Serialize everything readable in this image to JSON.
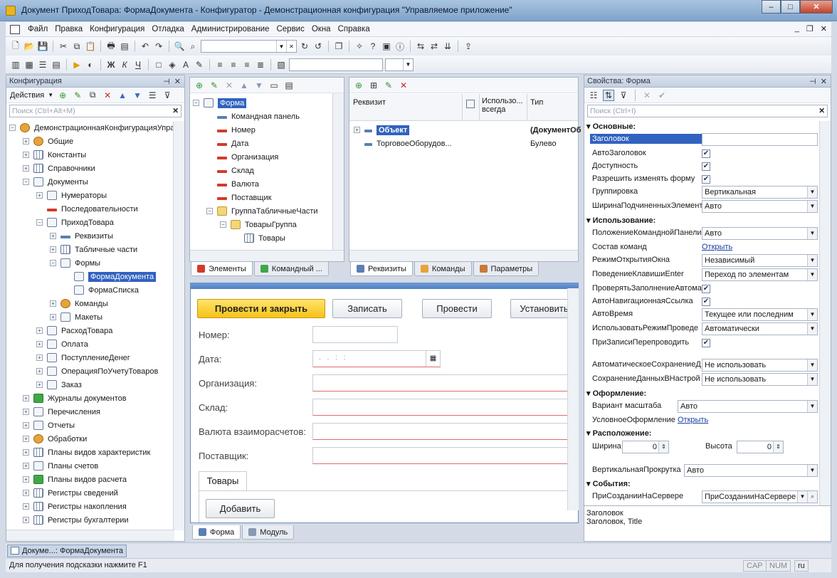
{
  "window": {
    "title": "Документ ПриходТовара: ФормаДокумента - Конфигуратор - Демонстрационная конфигурация \"Управляемое приложение\"",
    "min": "–",
    "max": "□",
    "close": "✕"
  },
  "menu": [
    "Файл",
    "Правка",
    "Конфигурация",
    "Отладка",
    "Администрирование",
    "Сервис",
    "Окна",
    "Справка"
  ],
  "mdi": {
    "min": "_",
    "restore": "❐",
    "close": "✕"
  },
  "toolbar": {
    "search_value": ""
  },
  "config_panel": {
    "title": "Конфигурация",
    "actions_label": "Действия",
    "search_placeholder": "Поиск (Ctrl+Alt+M)",
    "tree": [
      {
        "label": "ДемонстрационнаяКонфигурацияУправ",
        "level": 0,
        "icon": "gear"
      },
      {
        "label": "Общие",
        "level": 1,
        "icon": "gear"
      },
      {
        "label": "Константы",
        "level": 1,
        "icon": "grid"
      },
      {
        "label": "Справочники",
        "level": 1,
        "icon": "grid"
      },
      {
        "label": "Документы",
        "level": 1,
        "icon": "doc"
      },
      {
        "label": "Нумераторы",
        "level": 2,
        "icon": "num"
      },
      {
        "label": "Последовательности",
        "level": 2,
        "icon": "red"
      },
      {
        "label": "ПриходТовара",
        "level": 2,
        "icon": "doc"
      },
      {
        "label": "Реквизиты",
        "level": 3,
        "icon": "blue"
      },
      {
        "label": "Табличные части",
        "level": 3,
        "icon": "grid"
      },
      {
        "label": "Формы",
        "level": 3,
        "icon": "doc"
      },
      {
        "label": "ФормаДокумента",
        "level": 4,
        "icon": "doc"
      },
      {
        "label": "ФормаСписка",
        "level": 4,
        "icon": "doc"
      },
      {
        "label": "Команды",
        "level": 3,
        "icon": "gear"
      },
      {
        "label": "Макеты",
        "level": 3,
        "icon": "doc"
      },
      {
        "label": "РасходТовара",
        "level": 2,
        "icon": "doc"
      },
      {
        "label": "Оплата",
        "level": 2,
        "icon": "doc"
      },
      {
        "label": "ПоступлениеДенег",
        "level": 2,
        "icon": "doc"
      },
      {
        "label": "ОперацияПоУчетуТоваров",
        "level": 2,
        "icon": "doc"
      },
      {
        "label": "Заказ",
        "level": 2,
        "icon": "doc"
      },
      {
        "label": "Журналы документов",
        "level": 1,
        "icon": "green"
      },
      {
        "label": "Перечисления",
        "level": 1,
        "icon": "doc"
      },
      {
        "label": "Отчеты",
        "level": 1,
        "icon": "doc"
      },
      {
        "label": "Обработки",
        "level": 1,
        "icon": "gear"
      },
      {
        "label": "Планы видов характеристик",
        "level": 1,
        "icon": "grid"
      },
      {
        "label": "Планы счетов",
        "level": 1,
        "icon": "num"
      },
      {
        "label": "Планы видов расчета",
        "level": 1,
        "icon": "green"
      },
      {
        "label": "Регистры сведений",
        "level": 1,
        "icon": "grid"
      },
      {
        "label": "Регистры накопления",
        "level": 1,
        "icon": "grid"
      },
      {
        "label": "Регистры бухгалтерии",
        "level": 1,
        "icon": "grid"
      }
    ]
  },
  "elements_panel": {
    "tree": [
      {
        "label": "Форма",
        "level": 0,
        "icon": "doc",
        "selected": true
      },
      {
        "label": "Командная панель",
        "level": 1,
        "icon": "blue"
      },
      {
        "label": "Номер",
        "level": 1,
        "icon": "red"
      },
      {
        "label": "Дата",
        "level": 1,
        "icon": "red"
      },
      {
        "label": "Организация",
        "level": 1,
        "icon": "red"
      },
      {
        "label": "Склад",
        "level": 1,
        "icon": "red"
      },
      {
        "label": "Валюта",
        "level": 1,
        "icon": "red"
      },
      {
        "label": "Поставщик",
        "level": 1,
        "icon": "red"
      },
      {
        "label": "ГруппаТабличныеЧасти",
        "level": 1,
        "icon": "fold"
      },
      {
        "label": "ТоварыГруппа",
        "level": 2,
        "icon": "fold"
      },
      {
        "label": "Товары",
        "level": 3,
        "icon": "grid"
      }
    ],
    "tabs": [
      "Элементы",
      "Командный ..."
    ]
  },
  "attributes_panel": {
    "columns": [
      "Реквизит",
      "Использо... всегда",
      "Тип"
    ],
    "rows": [
      {
        "name": "Объект",
        "type": "(ДокументОб",
        "selected": true
      },
      {
        "name": "ТорговоеОборудов...",
        "type": "Булево"
      }
    ],
    "tabs": [
      "Реквизиты",
      "Команды",
      "Параметры"
    ]
  },
  "form_preview": {
    "buttons": [
      "Провести и закрыть",
      "Записать",
      "Провести",
      "Установить"
    ],
    "fields": [
      "Номер:",
      "Дата:",
      "Организация:",
      "Склад:",
      "Валюта взаиморасчетов:",
      "Поставщик:"
    ],
    "date_mask": ". .   : :",
    "tab": "Товары",
    "add_button": "Добавить"
  },
  "editor_tabs": [
    "Форма",
    "Модуль"
  ],
  "properties": {
    "title": "Свойства: Форма",
    "search_placeholder": "Поиск (Ctrl+I)",
    "sections": {
      "basic": "Основные:",
      "usage": "Использование:",
      "design": "Оформление:",
      "layout": "Расположение:",
      "events": "События:"
    },
    "rows": {
      "title_label": "Заголовок",
      "auto_title": "АвтоЗаголовок",
      "enabled": "Доступность",
      "allow_change": "Разрешить изменять форму",
      "grouping": "Группировка",
      "grouping_value": "Вертикальная",
      "child_width": "ШиринаПодчиненныхЭлемент",
      "child_width_value": "Авто",
      "cmdbar_pos": "ПоложениеКоманднойПанели",
      "cmdbar_pos_value": "Авто",
      "cmd_set": "Состав команд",
      "cmd_set_link": "Открыть",
      "open_mode": "РежимОткрытияОкна",
      "open_mode_value": "Независимый",
      "enter_behavior": "ПоведениеКлавишиEnter",
      "enter_behavior_value": "Переход по элементам",
      "check_fill": "ПроверятьЗаполнениеАвтома",
      "auto_nav": "АвтоНавигационнаяСсылка",
      "auto_time": "АвтоВремя",
      "auto_time_value": "Текущее или последним",
      "post_mode": "ИспользоватьРежимПроведе",
      "post_mode_value": "Автоматически",
      "repost": "ПриЗаписиПерепроводить",
      "autosave": "АвтоматическоеСохранениеД",
      "autosave_value": "Не использовать",
      "save_settings": "СохранениеДанныхВНастрой",
      "save_settings_value": "Не использовать",
      "scale": "Вариант масштаба",
      "scale_value": "Авто",
      "cond_design": "УсловноеОформление",
      "cond_design_link": "Открыть",
      "width": "Ширина",
      "width_value": "0",
      "height": "Высота",
      "height_value": "0",
      "vscroll": "ВертикальнаяПрокрутка",
      "vscroll_value": "Авто",
      "on_create": "ПриСозданииНаСервере",
      "on_create_value": "ПриСозданииНаСервере"
    },
    "footer_title": "Заголовок",
    "footer_desc": "Заголовок, Title"
  },
  "taskbar": {
    "label": "Докуме...: ФормаДокумента"
  },
  "status": {
    "hint": "Для получения подсказки нажмите F1",
    "cap": "CAP",
    "num": "NUM",
    "lang": "ru"
  }
}
